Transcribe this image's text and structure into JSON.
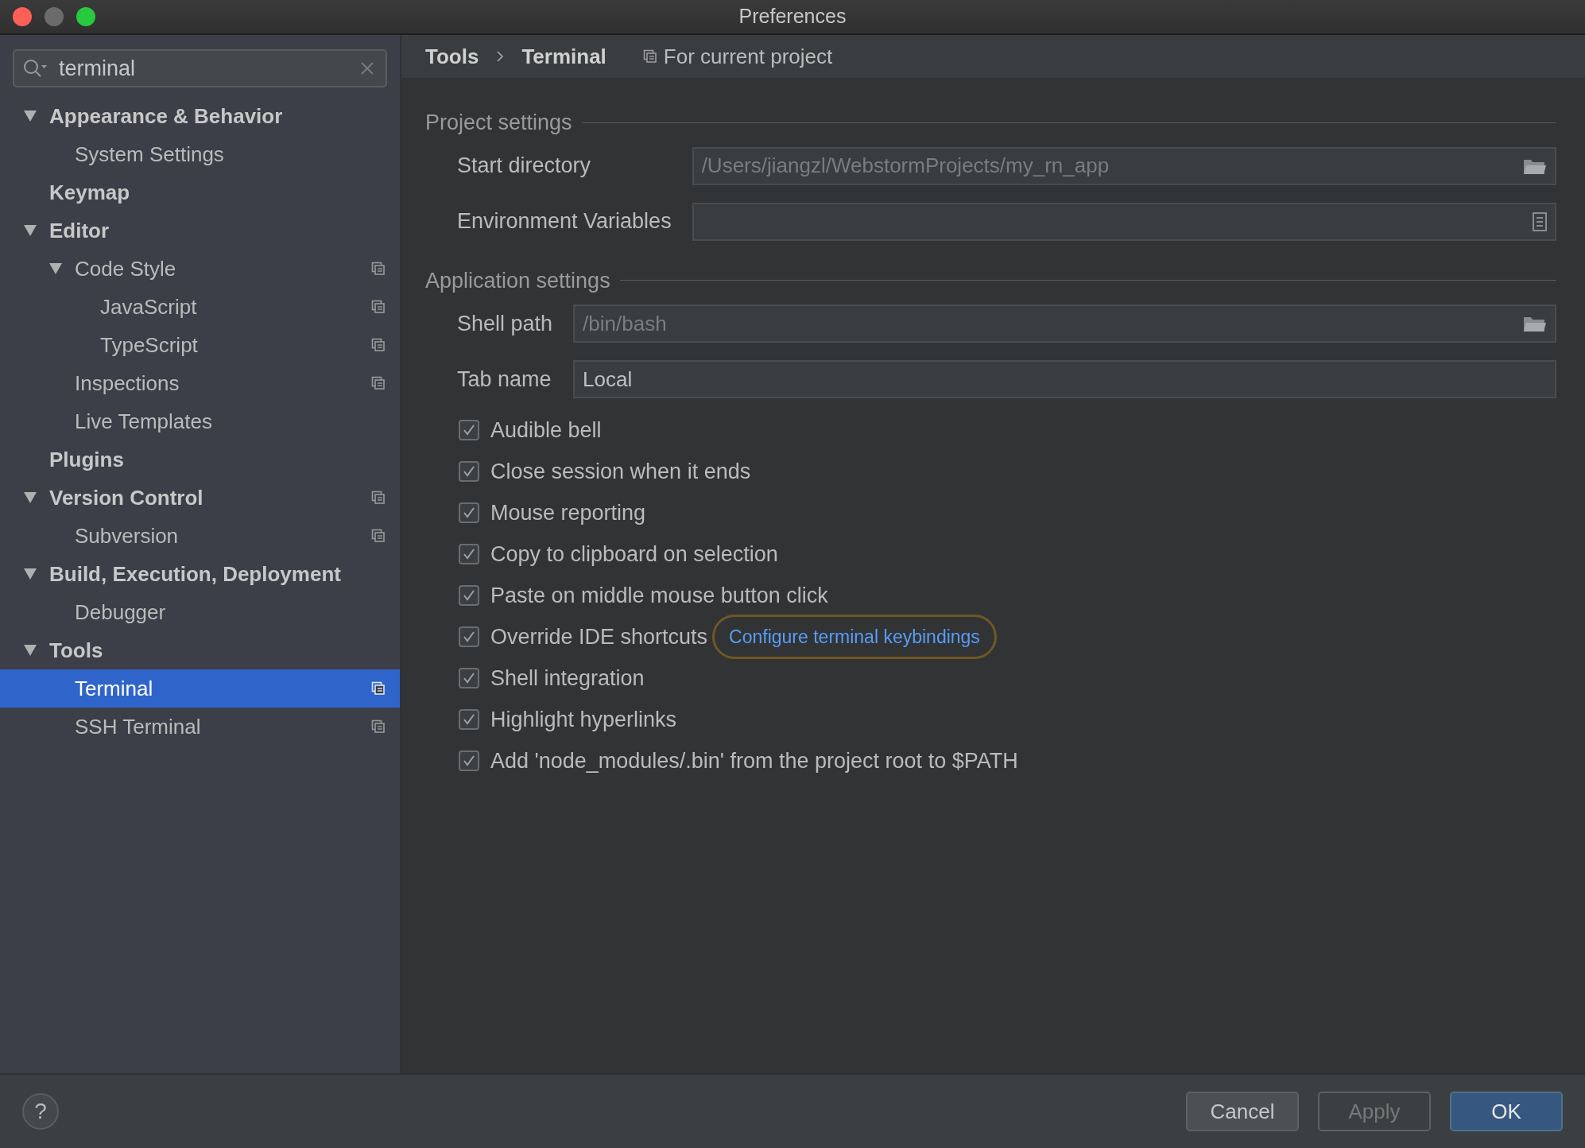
{
  "window": {
    "title": "Preferences"
  },
  "search": {
    "value": "terminal"
  },
  "sidebar": {
    "items": [
      {
        "label": "Appearance & Behavior",
        "expanded": true,
        "children": [
          {
            "label": "System Settings"
          }
        ]
      },
      {
        "label": "Keymap"
      },
      {
        "label": "Editor",
        "expanded": true,
        "children": [
          {
            "label": "Code Style",
            "expanded": true,
            "project_level": true,
            "children": [
              {
                "label": "JavaScript",
                "project_level": true
              },
              {
                "label": "TypeScript",
                "project_level": true
              }
            ]
          },
          {
            "label": "Inspections",
            "project_level": true
          },
          {
            "label": "Live Templates"
          }
        ]
      },
      {
        "label": "Plugins"
      },
      {
        "label": "Version Control",
        "expanded": true,
        "project_level": true,
        "children": [
          {
            "label": "Subversion",
            "project_level": true
          }
        ]
      },
      {
        "label": "Build, Execution, Deployment",
        "expanded": true,
        "children": [
          {
            "label": "Debugger"
          }
        ]
      },
      {
        "label": "Tools",
        "expanded": true,
        "children": [
          {
            "label": "Terminal",
            "project_level": true,
            "selected": true
          },
          {
            "label": "SSH Terminal",
            "project_level": true,
            "selected": false
          }
        ]
      }
    ]
  },
  "breadcrumb": {
    "path": [
      "Tools",
      "Terminal"
    ],
    "scope": "For current project"
  },
  "sections": [
    {
      "title": "Project settings",
      "fields": [
        {
          "label": "Start directory",
          "placeholder": "/Users/jiangzl/WebstormProjects/my_rn_app",
          "kind": "folder"
        },
        {
          "label": "Environment Variables",
          "kind": "list"
        }
      ]
    },
    {
      "title": "Application settings",
      "fields": [
        {
          "label": "Shell path",
          "placeholder": "/bin/bash",
          "kind": "folder"
        },
        {
          "label": "Tab name",
          "value": "Local",
          "kind": "text"
        }
      ],
      "checkboxes": [
        {
          "label": "Audible bell",
          "checked": true
        },
        {
          "label": "Close session when it ends",
          "checked": true
        },
        {
          "label": "Mouse reporting",
          "checked": true
        },
        {
          "label": "Copy to clipboard on selection",
          "checked": true
        },
        {
          "label": "Paste on middle mouse button click",
          "checked": true
        },
        {
          "label": "Override IDE shortcuts",
          "checked": true,
          "link": "Configure terminal keybindings"
        },
        {
          "label": "Shell integration",
          "checked": true
        },
        {
          "label": "Highlight hyperlinks",
          "checked": true
        },
        {
          "label": "Add 'node_modules/.bin' from the project root to $PATH",
          "checked": true
        }
      ]
    }
  ],
  "footer": {
    "help": "?",
    "buttons": [
      {
        "label": "Cancel",
        "disabled": false,
        "default": false
      },
      {
        "label": "Apply",
        "disabled": true,
        "default": false
      },
      {
        "label": "OK",
        "disabled": false,
        "default": true
      }
    ]
  }
}
